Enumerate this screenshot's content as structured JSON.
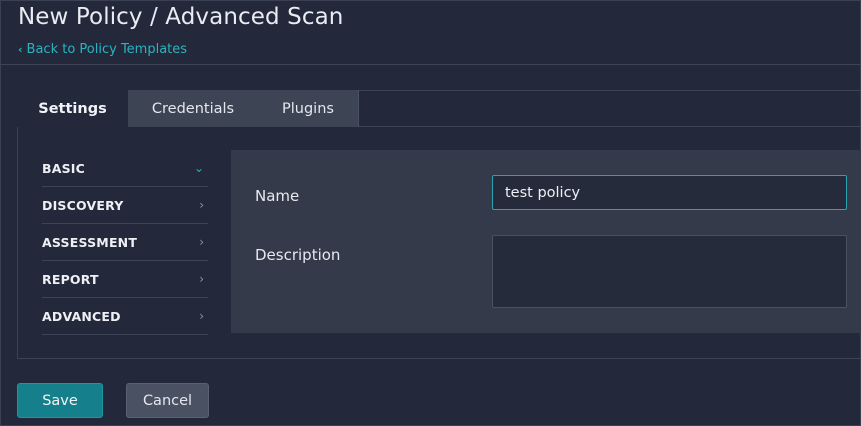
{
  "header": {
    "title": "New Policy / Advanced Scan",
    "back_link": "Back to Policy Templates"
  },
  "tabs": [
    {
      "label": "Settings",
      "active": true
    },
    {
      "label": "Credentials",
      "active": false
    },
    {
      "label": "Plugins",
      "active": false
    }
  ],
  "sidebar": {
    "items": [
      {
        "label": "BASIC",
        "expanded": true
      },
      {
        "label": "DISCOVERY",
        "expanded": false
      },
      {
        "label": "ASSESSMENT",
        "expanded": false
      },
      {
        "label": "REPORT",
        "expanded": false
      },
      {
        "label": "ADVANCED",
        "expanded": false
      }
    ]
  },
  "form": {
    "name_label": "Name",
    "name_value": "test policy",
    "description_label": "Description",
    "description_value": ""
  },
  "actions": {
    "save_label": "Save",
    "cancel_label": "Cancel"
  },
  "colors": {
    "background": "#23293a",
    "accent": "#2bb3c0",
    "primary_button": "#15808b",
    "secondary_button": "#4a5162",
    "form_panel": "#343a4a"
  },
  "icons": {
    "back": "chevron-left-icon",
    "expanded": "chevron-down-icon",
    "collapsed": "chevron-right-icon"
  }
}
